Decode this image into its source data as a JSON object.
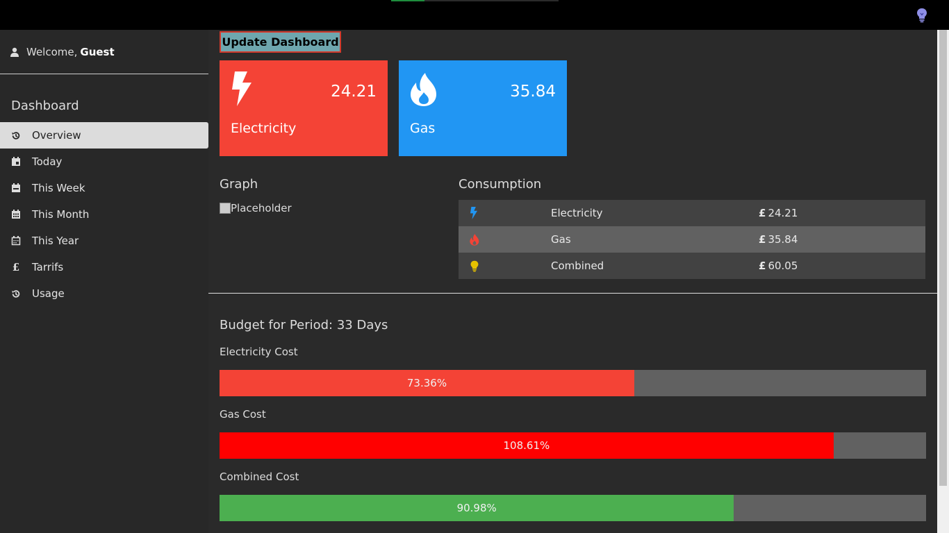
{
  "header": {
    "loading_progress": 0.2,
    "theme_icon": "lightbulb-icon"
  },
  "sidebar": {
    "welcome_prefix": "Welcome,",
    "welcome_user": "Guest",
    "section_title": "Dashboard",
    "items": [
      {
        "label": "Overview",
        "icon": "history-icon",
        "active": true
      },
      {
        "label": "Today",
        "icon": "calendar-day-icon"
      },
      {
        "label": "This Week",
        "icon": "calendar-week-icon"
      },
      {
        "label": "This Month",
        "icon": "calendar-month-icon"
      },
      {
        "label": "This Year",
        "icon": "calendar-year-icon"
      },
      {
        "label": "Tarrifs",
        "icon": "pound-icon"
      },
      {
        "label": "Usage",
        "icon": "history-icon"
      }
    ]
  },
  "main": {
    "update_button": "Update Dashboard",
    "cards": {
      "electricity": {
        "value": "24.21",
        "label": "Electricity",
        "color": "#f44336",
        "icon": "lightning-icon"
      },
      "gas": {
        "value": "35.84",
        "label": "Gas",
        "color": "#2196f3",
        "icon": "flame-icon"
      }
    },
    "graph": {
      "title": "Graph",
      "image_alt": "Placeholder"
    },
    "consumption": {
      "title": "Consumption",
      "currency_symbol": "£",
      "rows": [
        {
          "name": "Electricity",
          "value": "24.21",
          "icon": "lightning-icon",
          "icon_color": "#2196f3"
        },
        {
          "name": "Gas",
          "value": "35.84",
          "icon": "flame-icon",
          "icon_color": "#f44336"
        },
        {
          "name": "Combined",
          "value": "60.05",
          "icon": "lightbulb-icon",
          "icon_color": "#e6c200"
        }
      ]
    },
    "budget": {
      "title": "Budget for Period: 33 Days",
      "bars": [
        {
          "label": "Electricity Cost",
          "percent_text": "73.36%",
          "fill_fraction": 0.587,
          "color": "#f44336"
        },
        {
          "label": "Gas Cost",
          "percent_text": "108.61%",
          "fill_fraction": 0.869,
          "color": "#ff0000"
        },
        {
          "label": "Combined Cost",
          "percent_text": "90.98%",
          "fill_fraction": 0.728,
          "color": "#4caf50"
        }
      ]
    }
  }
}
